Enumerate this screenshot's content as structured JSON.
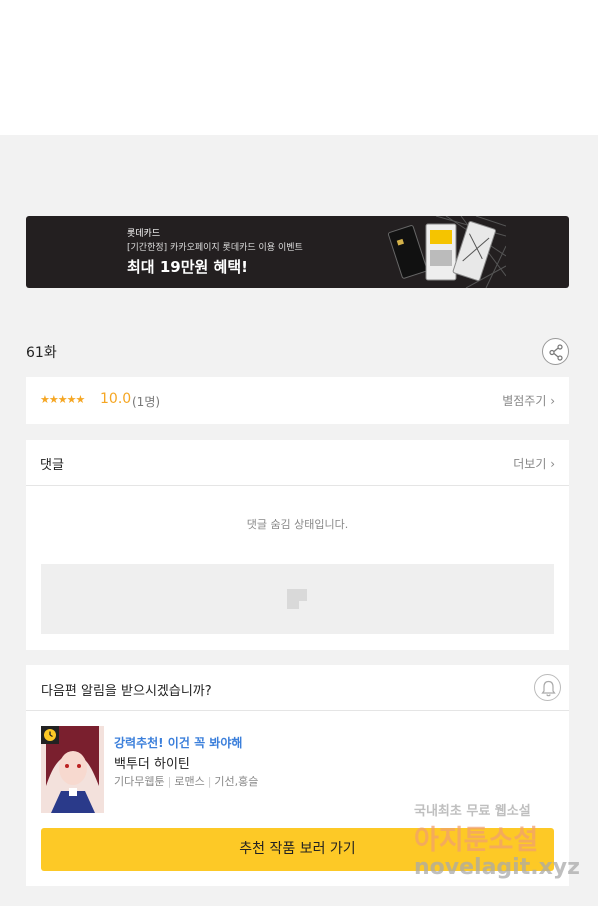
{
  "banner": {
    "brand": "롯데카드",
    "sub": "[기간한정] 카카오페이지 롯데카드 이용 이벤트",
    "headline": "최대 19만원 혜택!"
  },
  "episode": {
    "title": "61화"
  },
  "rating": {
    "stars": "★★★★★",
    "score": "10.0",
    "count": "(1명)",
    "rate_link": "별점주기 ›"
  },
  "comments": {
    "title": "댓글",
    "more": "더보기 ›",
    "hidden_message": "댓글 숨김 상태입니다."
  },
  "notify": {
    "question": "다음편 알림을 받으시겠습니까?"
  },
  "recommendation": {
    "tag": "강력추천! 이건 꼭 봐야해",
    "title": "백투더 하이틴",
    "meta": [
      "기다무웹툰",
      "로맨스",
      "기선,홍슬"
    ],
    "button": "추천 작품 보러 가기"
  },
  "watermark": {
    "line1": "국내최초 무료 웹소설",
    "line2": "아지툰소설",
    "line3": "novelagit.xyz"
  },
  "colors": {
    "accent_yellow": "#fdc926",
    "star_orange": "#f5a623",
    "link_blue": "#3b7fdb",
    "banner_bg": "#231f20"
  }
}
